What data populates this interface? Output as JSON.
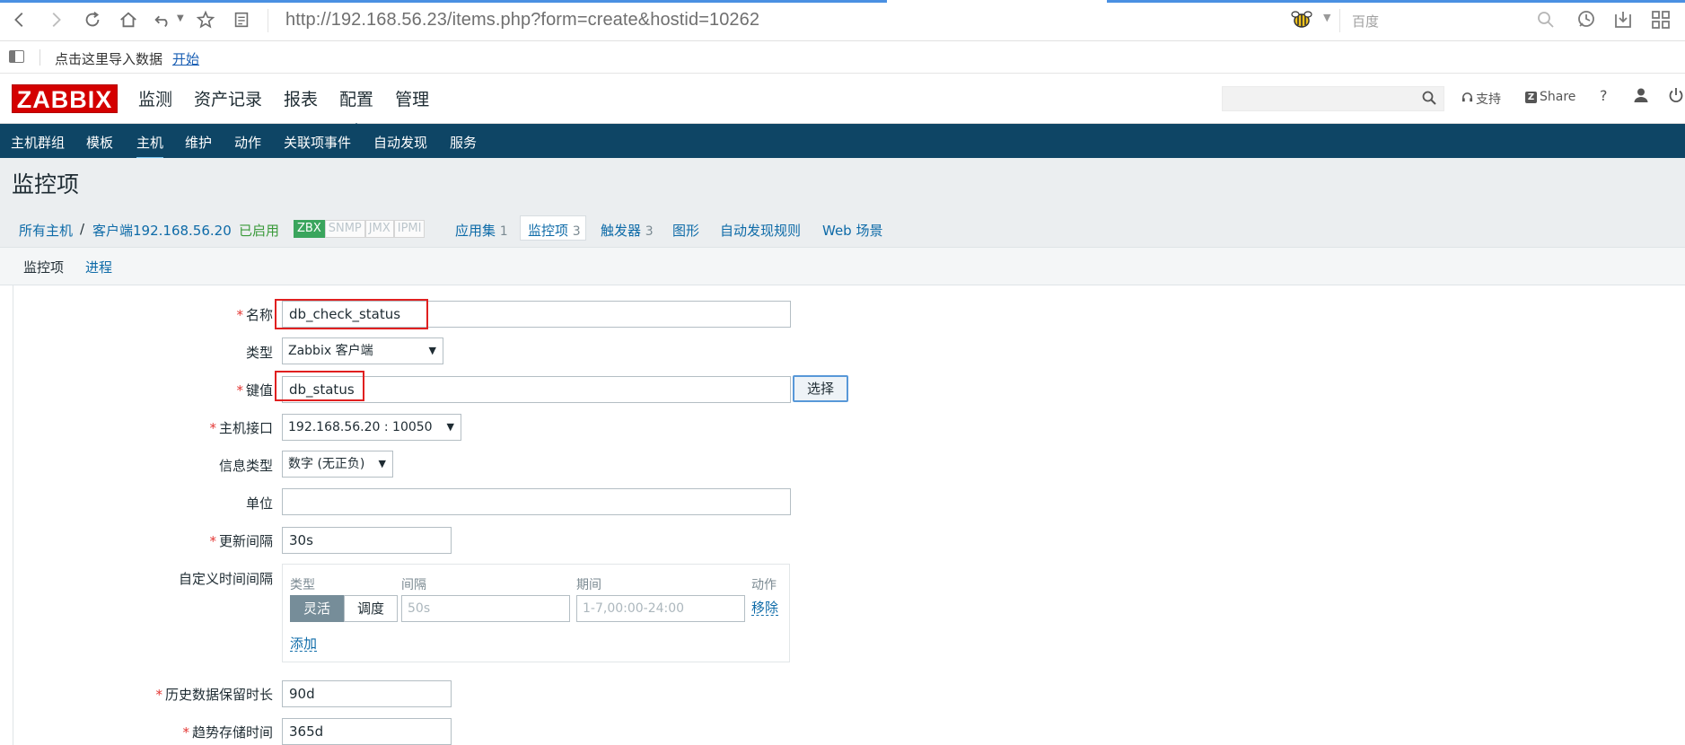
{
  "browser": {
    "url": "http://192.168.56.23/items.php?form=create&hostid=10262",
    "search_placeholder": "百度",
    "bookmark_text": "点击这里导入数据",
    "bookmark_link": "开始"
  },
  "header": {
    "logo": "ZABBIX",
    "menu": [
      "监测",
      "资产记录",
      "报表",
      "配置",
      "管理"
    ],
    "active_menu": "配置",
    "support": "支持",
    "share": "Share",
    "share_badge": "Z",
    "help": "?"
  },
  "submenu": [
    "主机群组",
    "模板",
    "主机",
    "维护",
    "动作",
    "关联项事件",
    "自动发现",
    "服务"
  ],
  "page_title": "监控项",
  "breadcrumb": {
    "all_hosts": "所有主机",
    "sep": "/",
    "host": "客户端192.168.56.20",
    "status": "已启用",
    "availability": [
      "ZBX",
      "SNMP",
      "JMX",
      "IPMI"
    ],
    "apps": "应用集",
    "apps_count": "1",
    "items": "监控项",
    "items_count": "3",
    "triggers": "触发器",
    "triggers_count": "3",
    "graphs": "图形",
    "discovery": "自动发现规则",
    "web": "Web 场景"
  },
  "tabs": [
    "监控项",
    "进程"
  ],
  "form": {
    "name_label": "名称",
    "name_value": "db_check_status",
    "type_label": "类型",
    "type_value": "Zabbix 客户端",
    "key_label": "键值",
    "key_value": "db_status",
    "select_button": "选择",
    "interface_label": "主机接口",
    "interface_value": "192.168.56.20 : 10050",
    "info_type_label": "信息类型",
    "info_type_value": "数字 (无正负)",
    "units_label": "单位",
    "units_value": "",
    "update_label": "更新间隔",
    "update_value": "30s",
    "custom_label": "自定义时间间隔",
    "custom": {
      "col_type": "类型",
      "col_interval": "间隔",
      "col_period": "期间",
      "col_action": "动作",
      "flexible": "灵活",
      "scheduling": "调度",
      "interval_placeholder": "50s",
      "period_placeholder": "1-7,00:00-24:00",
      "remove": "移除",
      "add": "添加"
    },
    "history_label": "历史数据保留时长",
    "history_value": "90d",
    "trends_label": "趋势存储时间",
    "trends_value": "365d"
  }
}
